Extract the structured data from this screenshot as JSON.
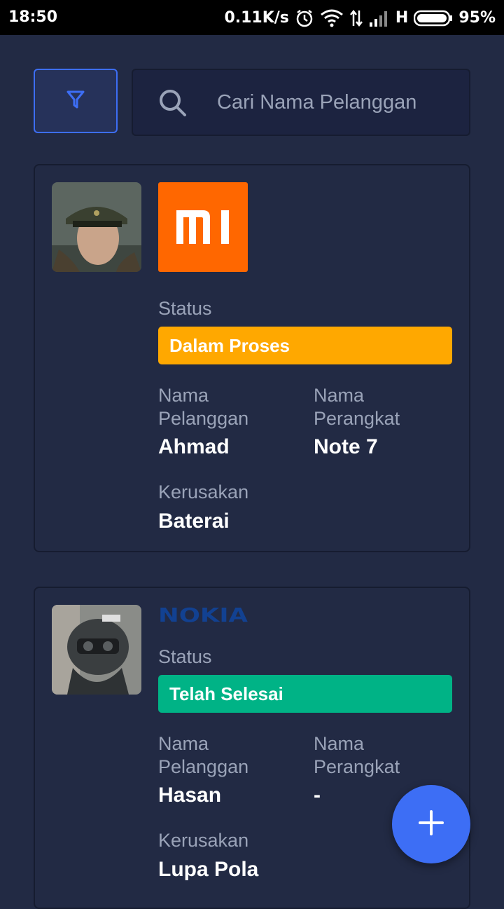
{
  "status_bar": {
    "time": "18:50",
    "net_speed": "0.11K/s",
    "network_type": "H",
    "battery": "95%",
    "icons": [
      "alarm-icon",
      "wifi-icon",
      "data-arrows-icon",
      "signal-icon",
      "battery-icon"
    ]
  },
  "search": {
    "placeholder": "Cari Nama Pelanggan",
    "value": ""
  },
  "filter": {
    "icon": "filter-icon"
  },
  "labels": {
    "status": "Status",
    "customer_name": "Nama Pelanggan",
    "device_name": "Nama Perangkat",
    "damage": "Kerusakan"
  },
  "orders": [
    {
      "brand": "mi",
      "brand_text": "mi",
      "status": "Dalam Proses",
      "status_color": "#ffa800",
      "customer": "Ahmad",
      "device": "Note 7",
      "damage": "Baterai"
    },
    {
      "brand": "nokia",
      "brand_text": "NOKIA",
      "status": "Telah Selesai",
      "status_color": "#00b386",
      "customer": "Hasan",
      "device": "-",
      "damage": "Lupa Pola"
    }
  ],
  "fab": {
    "icon": "plus-icon"
  },
  "colors": {
    "background": "#222a44",
    "accent": "#3d6ef5",
    "mi_orange": "#ff6700",
    "nokia_blue": "#124191"
  }
}
